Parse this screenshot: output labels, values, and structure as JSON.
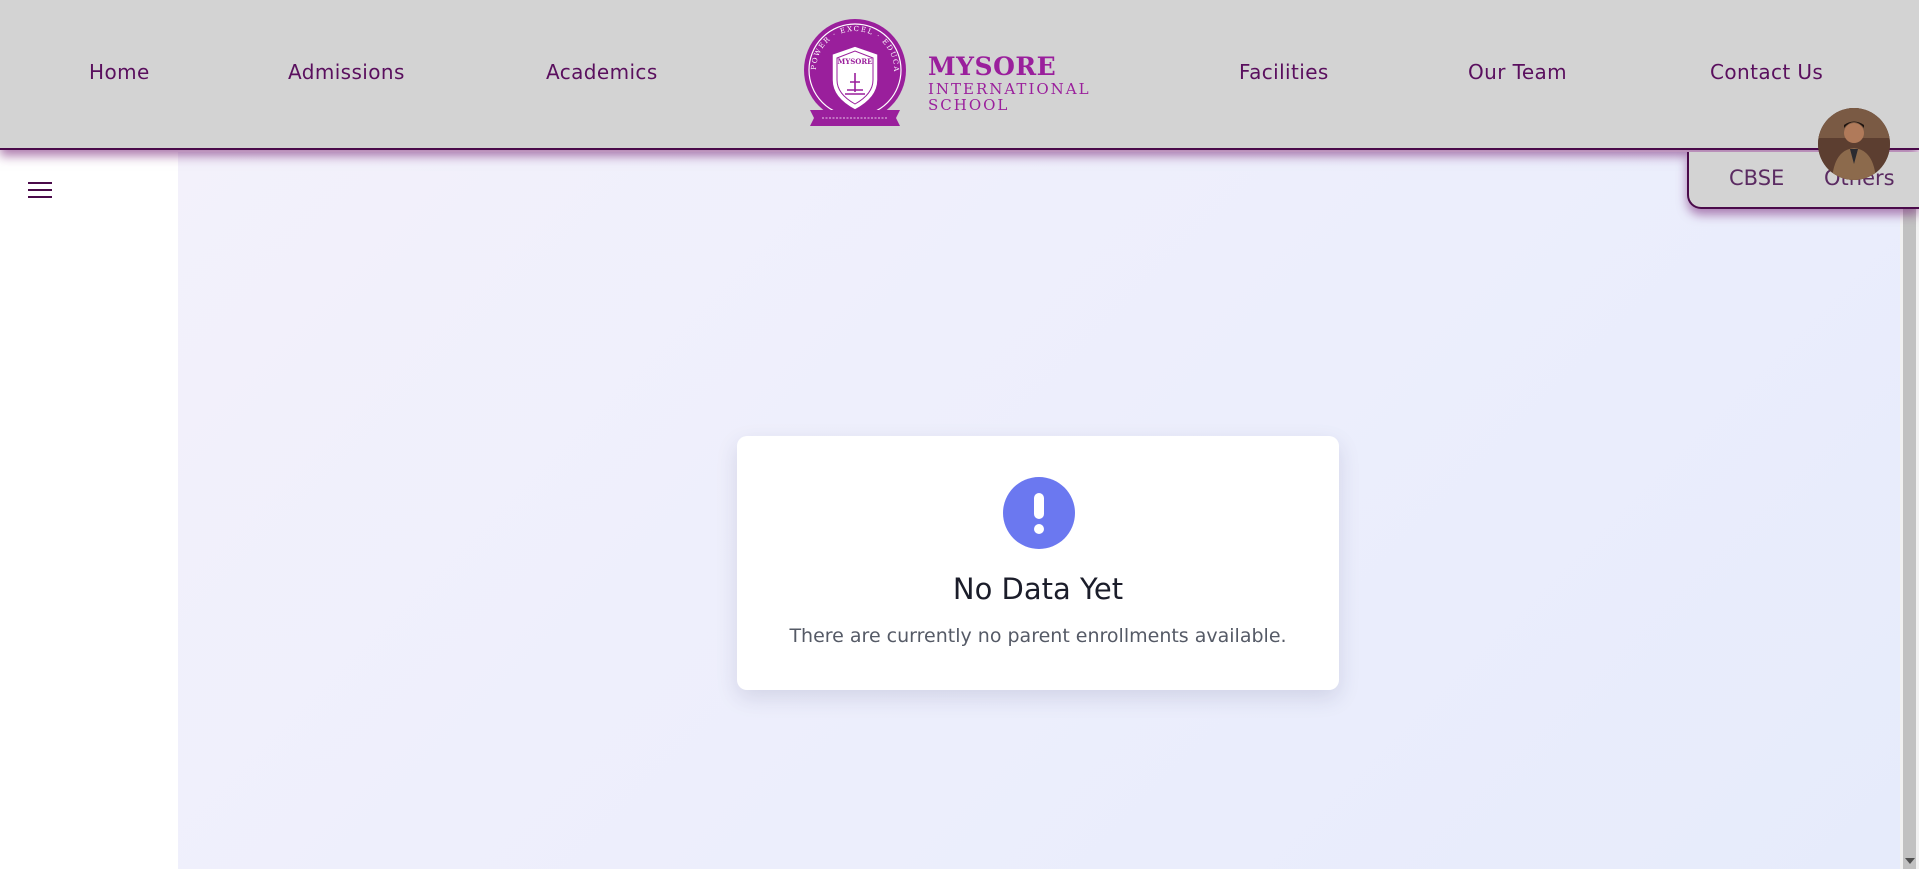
{
  "nav": {
    "home": "Home",
    "admissions": "Admissions",
    "academics": "Academics",
    "facilities": "Facilities",
    "our_team": "Our Team",
    "contact_us": "Contact Us"
  },
  "logo": {
    "name": "MYSORE",
    "line2": "INTERNATIONAL",
    "line3": "SCHOOL",
    "emblem_arc_top": "EMPOWER · EXCEL · EDUCATE",
    "emblem_name": "MYSORE"
  },
  "side_tabs": {
    "cbse": "CBSE",
    "others": "Others"
  },
  "empty_state": {
    "title": "No Data Yet",
    "message": "There are currently no parent enrollments available.",
    "icon": "exclamation-circle-icon"
  },
  "colors": {
    "brand_purple": "#9a1f9c",
    "nav_text": "#5a0f5e",
    "header_bg": "#d3d3d3",
    "accent_icon": "#6b78f0"
  },
  "icons": {
    "menu": "hamburger-menu-icon",
    "avatar": "user-avatar"
  }
}
